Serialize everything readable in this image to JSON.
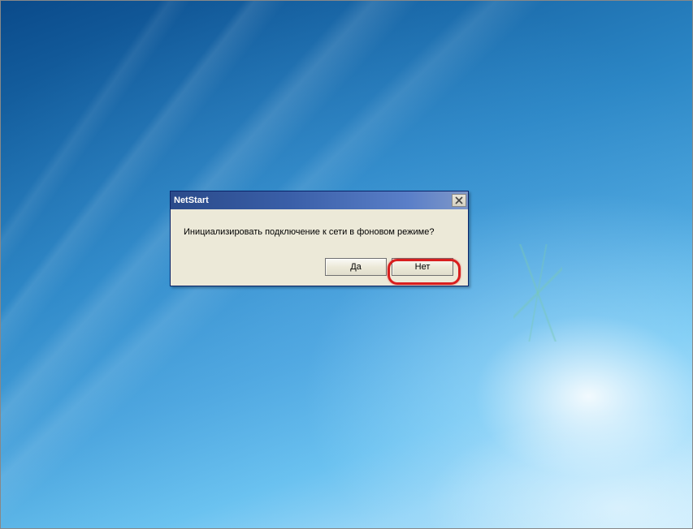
{
  "dialog": {
    "title": "NetStart",
    "message": "Инициализировать подключение к сети в фоновом режиме?",
    "buttons": {
      "yes": "Да",
      "no": "Нет"
    }
  },
  "highlight": {
    "target": "no-button"
  }
}
